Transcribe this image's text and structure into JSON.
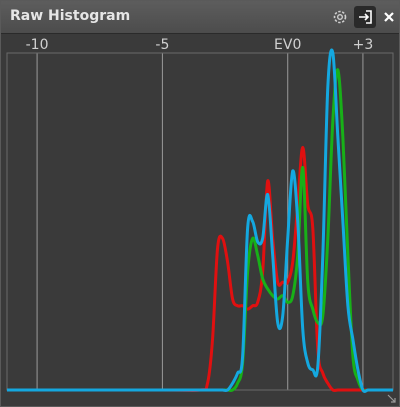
{
  "panel": {
    "title": "Raw Histogram",
    "icons": {
      "settings": "gear-icon",
      "dock": "dock-icon",
      "close": "close-icon",
      "resize": "resize-grip-icon"
    }
  },
  "chart_data": {
    "type": "line",
    "xlabel": "",
    "ylabel": "",
    "xlim": [
      -11.2,
      4.2
    ],
    "ylim": [
      0,
      1.0
    ],
    "grid": "vertical",
    "x_ticks": [
      {
        "value": -10,
        "label": "-10"
      },
      {
        "value": -5,
        "label": "-5"
      },
      {
        "value": 0,
        "label": "EV0"
      },
      {
        "value": 3,
        "label": "+3"
      }
    ],
    "x": [
      -11.2,
      -5.0,
      -3.5,
      -3.2,
      -3.0,
      -2.8,
      -2.6,
      -2.4,
      -2.2,
      -2.0,
      -1.8,
      -1.6,
      -1.4,
      -1.2,
      -1.0,
      -0.8,
      -0.6,
      -0.4,
      -0.2,
      0.0,
      0.2,
      0.4,
      0.6,
      0.8,
      1.0,
      1.2,
      1.4,
      1.6,
      1.8,
      2.0,
      2.2,
      2.4,
      2.6,
      2.8,
      3.0,
      3.2,
      3.4,
      3.6,
      4.2
    ],
    "series": [
      {
        "color": "#e01010",
        "values": [
          0.0,
          0.0,
          0.0,
          0.02,
          0.15,
          0.42,
          0.45,
          0.38,
          0.27,
          0.25,
          0.25,
          0.24,
          0.25,
          0.26,
          0.35,
          0.62,
          0.45,
          0.32,
          0.32,
          0.32,
          0.38,
          0.55,
          0.72,
          0.55,
          0.48,
          0.12,
          0.05,
          0.02,
          0.0,
          0.0,
          0.0,
          0.0,
          0.0,
          0.0,
          0.0,
          0.0,
          0.0,
          0.0,
          0.0
        ]
      },
      {
        "color": "#18b018",
        "values": [
          0.0,
          0.0,
          0.0,
          0.0,
          0.0,
          0.0,
          0.0,
          0.0,
          0.0,
          0.02,
          0.08,
          0.35,
          0.45,
          0.4,
          0.33,
          0.3,
          0.28,
          0.27,
          0.28,
          0.26,
          0.28,
          0.4,
          0.66,
          0.32,
          0.24,
          0.2,
          0.22,
          0.45,
          0.8,
          0.95,
          0.75,
          0.4,
          0.1,
          0.03,
          0.0,
          0.0,
          0.0,
          0.0,
          0.0
        ]
      },
      {
        "color": "#14a8e0",
        "values": [
          0.0,
          0.0,
          0.0,
          0.0,
          0.0,
          0.0,
          0.0,
          0.0,
          0.02,
          0.05,
          0.1,
          0.48,
          0.5,
          0.44,
          0.45,
          0.58,
          0.4,
          0.2,
          0.22,
          0.45,
          0.65,
          0.5,
          0.18,
          0.08,
          0.06,
          0.07,
          0.4,
          0.9,
          1.0,
          0.75,
          0.5,
          0.25,
          0.15,
          0.06,
          0.0,
          0.0,
          0.0,
          0.0,
          0.0
        ]
      }
    ]
  }
}
